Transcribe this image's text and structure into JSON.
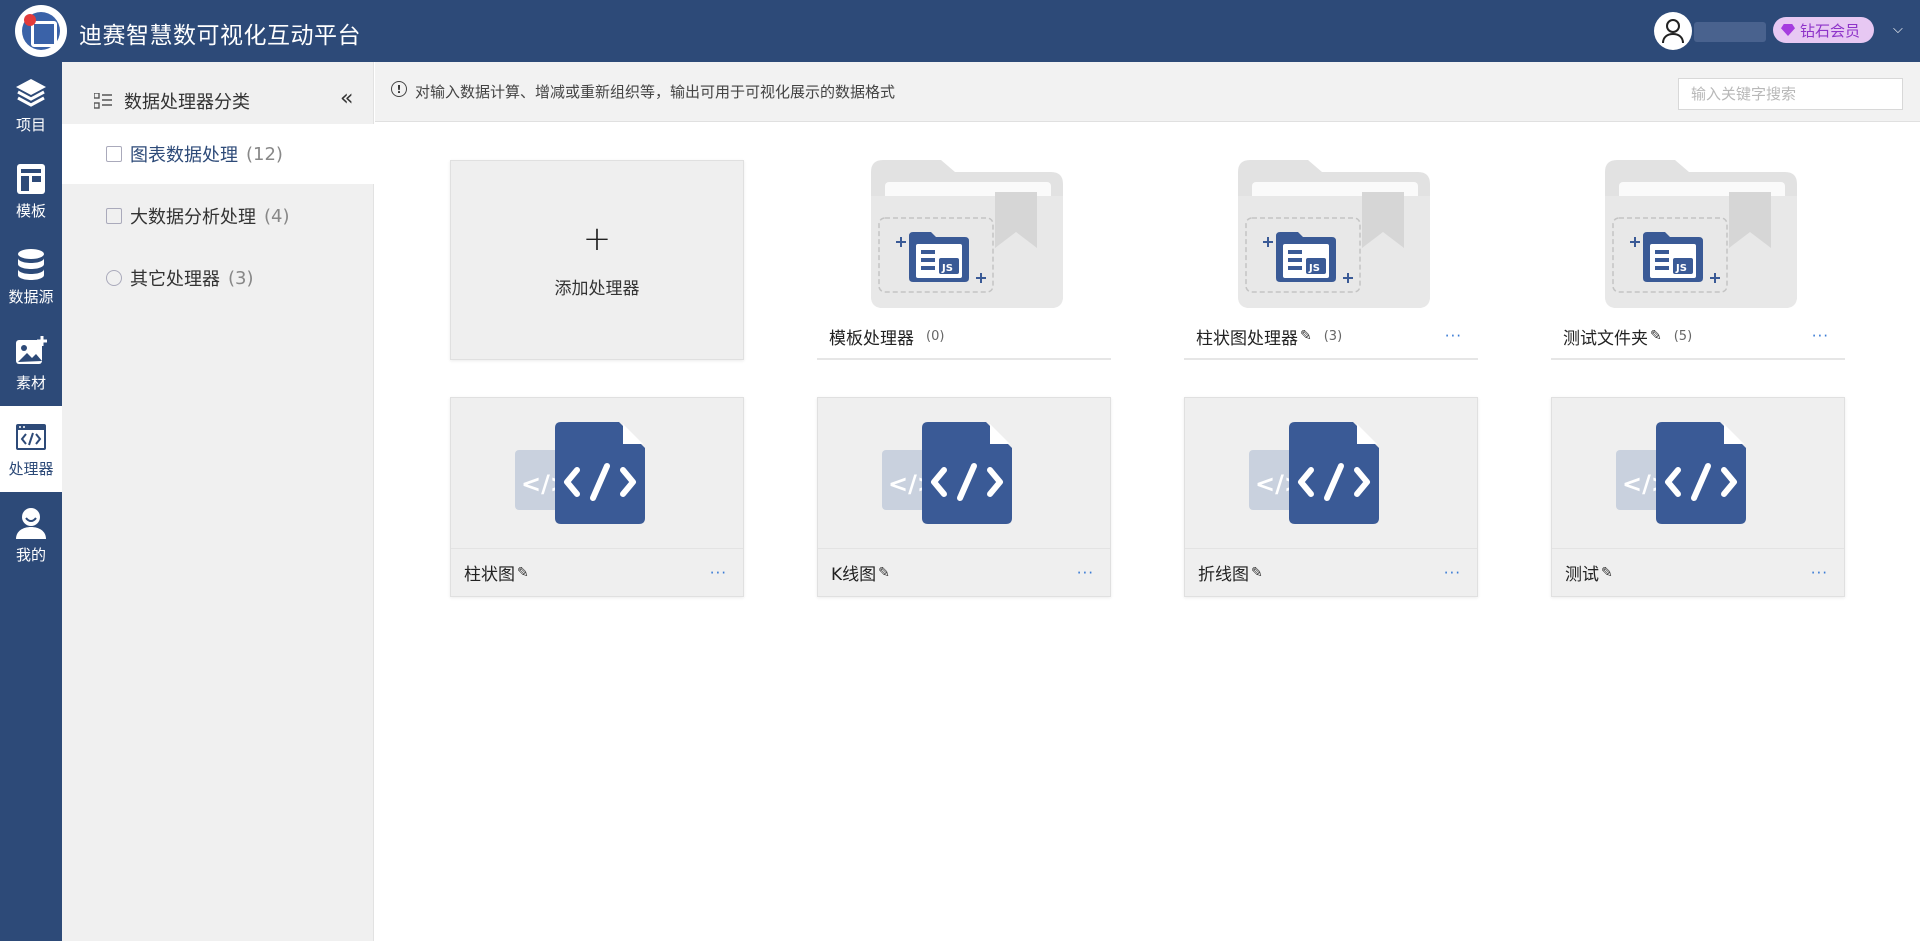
{
  "app": {
    "title": "迪赛智慧数可视化互动平台"
  },
  "header": {
    "vip_label": "钻石会员",
    "caret": "⌵"
  },
  "nav": {
    "items": [
      {
        "label": "项目",
        "icon": "layers-icon"
      },
      {
        "label": "模板",
        "icon": "template-icon"
      },
      {
        "label": "数据源",
        "icon": "database-icon"
      },
      {
        "label": "素材",
        "icon": "image-add-icon"
      },
      {
        "label": "处理器",
        "icon": "code-window-icon",
        "active": true
      },
      {
        "label": "我的",
        "icon": "user-icon"
      }
    ]
  },
  "categories": {
    "header": "数据处理器分类",
    "collapse": "«",
    "items": [
      {
        "label": "图表数据处理",
        "count": "(12)",
        "active": true
      },
      {
        "label": "大数据分析处理",
        "count": "(4)"
      },
      {
        "label": "其它处理器",
        "count": "(3)"
      }
    ]
  },
  "info": {
    "icon_glyph": "!",
    "text": "对输入数据计算、增减或重新组织等，输出可用于可视化展示的数据格式",
    "search_placeholder": "输入关键字搜索"
  },
  "add_card": {
    "plus": "+",
    "label": "添加处理器"
  },
  "folders": [
    {
      "name": "模板处理器",
      "count": "(0)",
      "editable": false
    },
    {
      "name": "柱状图处理器",
      "count": "(3)",
      "editable": true,
      "more": "···"
    },
    {
      "name": "测试文件夹",
      "count": "(5)",
      "editable": true,
      "more": "···"
    }
  ],
  "processors": [
    {
      "name": "柱状图",
      "more": "···"
    },
    {
      "name": "K线图",
      "more": "···"
    },
    {
      "name": "折线图",
      "more": "···"
    },
    {
      "name": "测试",
      "more": "···"
    }
  ],
  "edit_glyph": "✎",
  "colors": {
    "primary": "#2d4a78",
    "accent_blue": "#3a7bd5",
    "vip": "#8e33c9"
  }
}
